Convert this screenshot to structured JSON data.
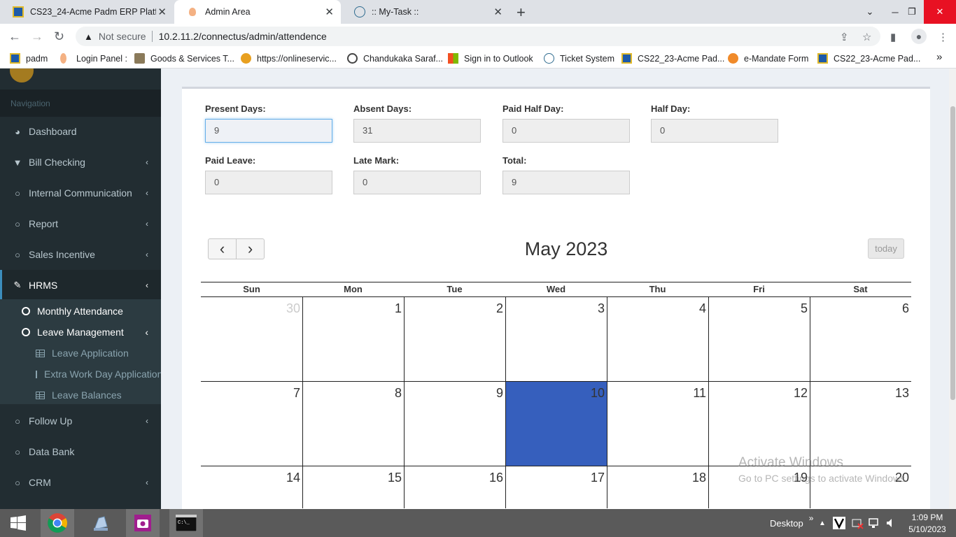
{
  "browser": {
    "tabs": [
      {
        "title": "CS23_24-Acme Padm ERP Platfor",
        "active": false
      },
      {
        "title": "Admin Area",
        "active": true
      },
      {
        "title": ":: My-Task ::",
        "active": false
      }
    ],
    "new_tab": "+",
    "address": {
      "security_label": "Not secure",
      "url": "10.2.11.2/connectus/admin/attendence"
    },
    "bookmarks": [
      "padm",
      "Login Panel :",
      "Goods & Services T...",
      "https://onlineservic...",
      "Chandukaka Saraf...",
      "Sign in to Outlook",
      "Ticket System",
      "CS22_23-Acme Pad...",
      "e-Mandate Form",
      "CS22_23-Acme Pad..."
    ],
    "bookmarks_more": "»"
  },
  "sidebar": {
    "header": "Navigation",
    "items": [
      {
        "label": "Dashboard",
        "icon": "dashboard-icon",
        "chevron": false
      },
      {
        "label": "Bill Checking",
        "icon": "filter-icon",
        "chevron": true
      },
      {
        "label": "Internal Communication",
        "icon": "circle-icon",
        "chevron": true
      },
      {
        "label": "Report",
        "icon": "circle-icon",
        "chevron": true
      },
      {
        "label": "Sales Incentive",
        "icon": "circle-icon",
        "chevron": true
      },
      {
        "label": "HRMS",
        "icon": "pencil-icon",
        "chevron": true
      },
      {
        "label": "Follow Up",
        "icon": "circle-icon",
        "chevron": true
      },
      {
        "label": "Data Bank",
        "icon": "circle-icon",
        "chevron": false
      },
      {
        "label": "CRM",
        "icon": "circle-icon",
        "chevron": true
      }
    ],
    "hrms_sub": [
      {
        "label": "Monthly Attendance"
      },
      {
        "label": "Leave Management"
      }
    ],
    "leave_sub": [
      "Leave Application",
      "Extra Work Day Application",
      "Leave Balances"
    ]
  },
  "summary": {
    "present_days": {
      "label": "Present Days:",
      "value": "9"
    },
    "absent_days": {
      "label": "Absent Days:",
      "value": "31"
    },
    "paid_half_day": {
      "label": "Paid Half Day:",
      "value": "0"
    },
    "half_day": {
      "label": "Half Day:",
      "value": "0"
    },
    "paid_leave": {
      "label": "Paid Leave:",
      "value": "0"
    },
    "late_mark": {
      "label": "Late Mark:",
      "value": "0"
    },
    "total": {
      "label": "Total:",
      "value": "9"
    }
  },
  "calendar": {
    "title": "May 2023",
    "today_button": "today",
    "prev": "‹",
    "next": "›",
    "days_of_week": [
      "Sun",
      "Mon",
      "Tue",
      "Wed",
      "Thu",
      "Fri",
      "Sat"
    ],
    "weeks": [
      [
        "30",
        "1",
        "2",
        "3",
        "4",
        "5",
        "6"
      ],
      [
        "7",
        "8",
        "9",
        "10",
        "11",
        "12",
        "13"
      ],
      [
        "14",
        "15",
        "16",
        "17",
        "18",
        "19",
        "20"
      ]
    ],
    "today_date": "10",
    "other_month_dates": [
      "30"
    ],
    "today_color": "#365fbd"
  },
  "watermark": {
    "line1": "Activate Windows",
    "line2": "Go to PC settings to activate Windows."
  },
  "taskbar": {
    "desktop_label": "Desktop",
    "chevrons": "»",
    "time": "1:09 PM",
    "date": "5/10/2023"
  }
}
